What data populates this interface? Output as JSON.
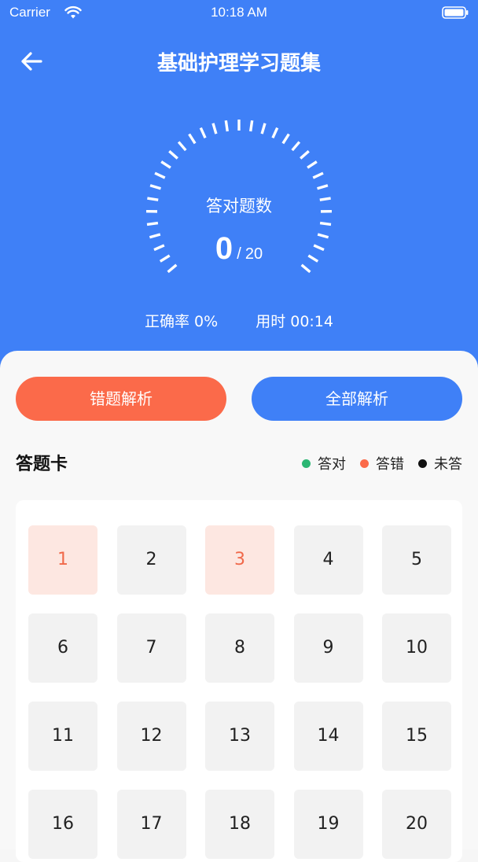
{
  "status_bar": {
    "carrier": "Carrier",
    "time": "10:18 AM"
  },
  "header": {
    "title": "基础护理学习题集",
    "gauge_label": "答对题数",
    "correct_count": "0",
    "separator": "/",
    "total_count": "20",
    "accuracy": "正确率 0%",
    "time_used": "用时 00:14"
  },
  "buttons": {
    "wrong_analysis": "错题解析",
    "all_analysis": "全部解析"
  },
  "answer_card": {
    "title": "答题卡",
    "legend": [
      {
        "label": "答对",
        "color": "#2bb673"
      },
      {
        "label": "答错",
        "color": "#fb6a4a"
      },
      {
        "label": "未答",
        "color": "#111111"
      }
    ],
    "questions": [
      {
        "num": "1",
        "state": "wrong"
      },
      {
        "num": "2",
        "state": "unanswered"
      },
      {
        "num": "3",
        "state": "wrong"
      },
      {
        "num": "4",
        "state": "unanswered"
      },
      {
        "num": "5",
        "state": "unanswered"
      },
      {
        "num": "6",
        "state": "unanswered"
      },
      {
        "num": "7",
        "state": "unanswered"
      },
      {
        "num": "8",
        "state": "unanswered"
      },
      {
        "num": "9",
        "state": "unanswered"
      },
      {
        "num": "10",
        "state": "unanswered"
      },
      {
        "num": "11",
        "state": "unanswered"
      },
      {
        "num": "12",
        "state": "unanswered"
      },
      {
        "num": "13",
        "state": "unanswered"
      },
      {
        "num": "14",
        "state": "unanswered"
      },
      {
        "num": "15",
        "state": "unanswered"
      },
      {
        "num": "16",
        "state": "unanswered"
      },
      {
        "num": "17",
        "state": "unanswered"
      },
      {
        "num": "18",
        "state": "unanswered"
      },
      {
        "num": "19",
        "state": "unanswered"
      },
      {
        "num": "20",
        "state": "unanswered"
      }
    ]
  },
  "colors": {
    "primary": "#3f80f7",
    "accent": "#fb6a4a"
  }
}
